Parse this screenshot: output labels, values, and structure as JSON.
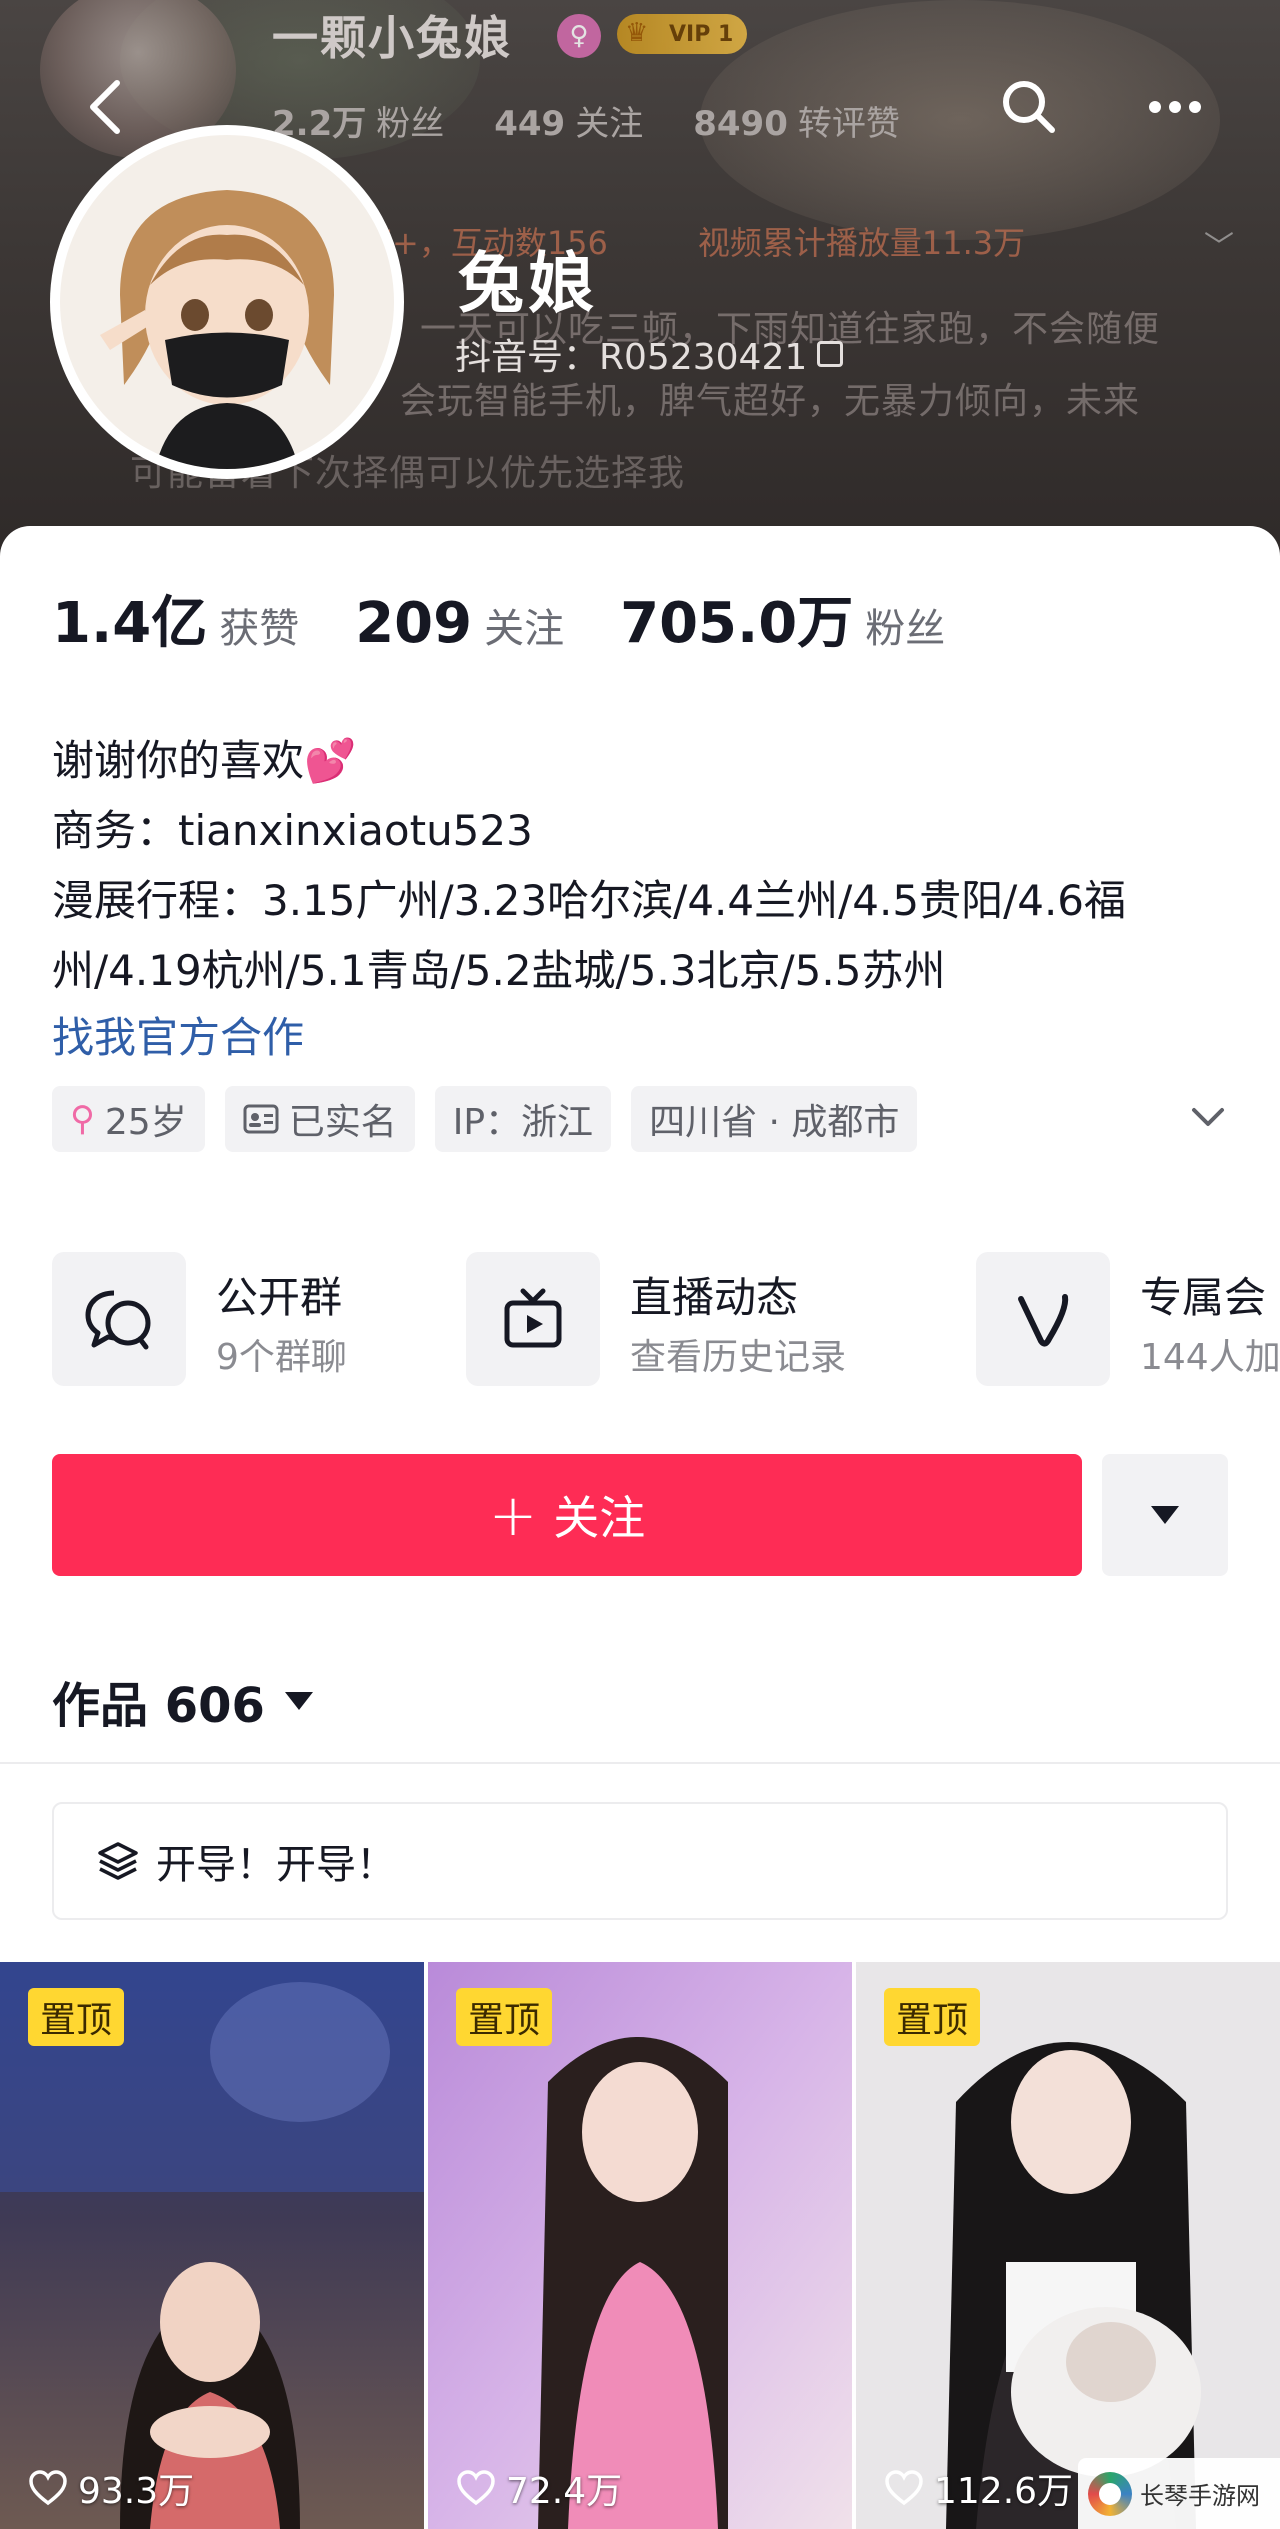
{
  "header": {
    "top_name": "一颗小兔娘",
    "female_badge": "♀",
    "vip_label": "VIP 1",
    "top_stats": [
      {
        "value": "2.2万",
        "label": "粉丝"
      },
      {
        "value": "449",
        "label": "关注"
      },
      {
        "value": "8490",
        "label": "转评赞"
      }
    ],
    "faded_info": [
      "万+，互动数156",
      "视频累计播放量11.3万"
    ],
    "faded_bio": [
      "一天可以吃三顿，下雨知道往家跑，不会随便",
      "会玩智能手机，脾气超好，无暴力倾向，未来",
      "可能留着下次择偶可以优先选择我"
    ],
    "nickname": "兔娘",
    "douyin_id": "抖音号：R05230421",
    "icons": {
      "back": "chevron-left-icon",
      "search": "search-icon",
      "more": "more-dots-icon"
    }
  },
  "profile": {
    "stats": [
      {
        "value": "1.4亿",
        "label": "获赞"
      },
      {
        "value": "209",
        "label": "关注"
      },
      {
        "value": "705.0万",
        "label": "粉丝"
      }
    ],
    "bio_lines": [
      "谢谢你的喜欢",
      "商务：tianxinxiaotu523",
      "漫展行程：3.15广州/3.23哈尔滨/4.4兰州/4.5贵阳/4.6福",
      "州/4.19杭州/5.1青岛/5.2盐城/5.3北京/5.5苏州"
    ],
    "bio_emoji": "💕",
    "collab_link": "找我官方合作",
    "tags": [
      {
        "icon": "female-icon",
        "label": "25岁"
      },
      {
        "icon": "id-card-icon",
        "label": "已实名"
      },
      {
        "icon": "",
        "label": "IP：浙江"
      },
      {
        "icon": "",
        "label": "四川省 · 成都市"
      }
    ],
    "features": [
      {
        "icon": "group-chat-icon",
        "title": "公开群",
        "sub": "9个群聊"
      },
      {
        "icon": "live-tv-icon",
        "title": "直播动态",
        "sub": "查看历史记录"
      },
      {
        "icon": "v-logo-icon",
        "title": "专属会",
        "sub": "144人加"
      }
    ],
    "follow_label": "关注",
    "follow_plus": "+",
    "works_label": "作品 606",
    "collection_label": "开导！开导！"
  },
  "videos": [
    {
      "pinned": "置顶",
      "likes": "93.3万"
    },
    {
      "pinned": "置顶",
      "likes": "72.4万"
    },
    {
      "pinned": "置顶",
      "likes": "112.6万"
    }
  ],
  "watermark": {
    "text": "长琴手游网"
  },
  "colors": {
    "accent": "#fe2c55",
    "link": "#2f5ea8",
    "pin": "#ffd731",
    "tag_bg": "#f2f2f4"
  }
}
